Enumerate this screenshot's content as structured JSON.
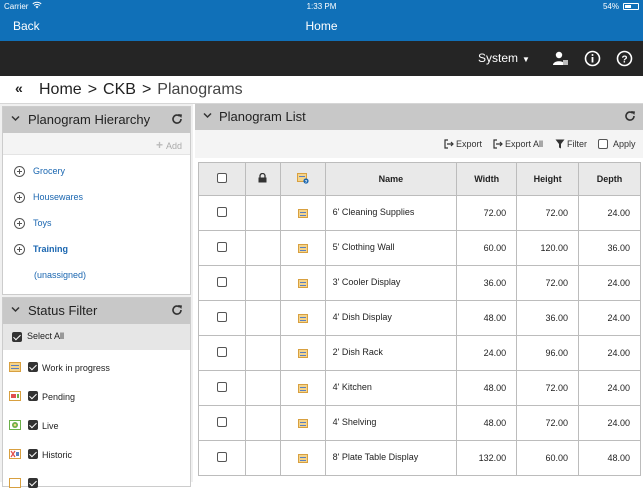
{
  "statusbar": {
    "carrier": "Carrier",
    "time": "1:33 PM",
    "battery": "54%",
    "battery_level": 0.54
  },
  "navbar": {
    "back_label": "Back",
    "title": "Home"
  },
  "toolbar": {
    "system_label": "System",
    "icons": [
      "user-icon",
      "info-icon",
      "help-icon"
    ]
  },
  "breadcrumb": {
    "collapse_glyph": "«",
    "items": [
      "Home",
      "CKB",
      "Planograms"
    ],
    "separator": ">"
  },
  "hierarchy": {
    "title": "Planogram Hierarchy",
    "add_label": "Add",
    "items": [
      {
        "label": "Grocery",
        "expandable": true,
        "bold": false
      },
      {
        "label": "Housewares",
        "expandable": true,
        "bold": false
      },
      {
        "label": "Toys",
        "expandable": true,
        "bold": false
      },
      {
        "label": "Training",
        "expandable": true,
        "bold": true
      },
      {
        "label": "(unassigned)",
        "expandable": false,
        "bold": false
      }
    ]
  },
  "status_filter": {
    "title": "Status Filter",
    "select_all_label": "Select All",
    "select_all_checked": true,
    "items": [
      {
        "label": "Work in progress",
        "checked": true,
        "icon": "wip-status-icon"
      },
      {
        "label": "Pending",
        "checked": true,
        "icon": "pending-status-icon"
      },
      {
        "label": "Live",
        "checked": true,
        "icon": "live-status-icon"
      },
      {
        "label": "Historic",
        "checked": true,
        "icon": "historic-status-icon"
      }
    ]
  },
  "planogram_list": {
    "title": "Planogram List",
    "toolbar": {
      "export": "Export",
      "export_all": "Export All",
      "filter": "Filter",
      "apply": "Apply"
    },
    "columns": [
      "",
      "",
      "",
      "Name",
      "Width",
      "Height",
      "Depth"
    ],
    "rows": [
      {
        "name": "6' Cleaning Supplies",
        "width": "72.00",
        "height": "72.00",
        "depth": "24.00"
      },
      {
        "name": "5' Clothing Wall",
        "width": "60.00",
        "height": "120.00",
        "depth": "36.00"
      },
      {
        "name": "3' Cooler Display",
        "width": "36.00",
        "height": "72.00",
        "depth": "24.00"
      },
      {
        "name": "4' Dish Display",
        "width": "48.00",
        "height": "36.00",
        "depth": "24.00"
      },
      {
        "name": "2' Dish Rack",
        "width": "24.00",
        "height": "96.00",
        "depth": "24.00"
      },
      {
        "name": "4' Kitchen",
        "width": "48.00",
        "height": "72.00",
        "depth": "24.00"
      },
      {
        "name": "4' Shelving",
        "width": "48.00",
        "height": "72.00",
        "depth": "24.00"
      },
      {
        "name": "8' Plate Table Display",
        "width": "132.00",
        "height": "60.00",
        "depth": "48.00"
      }
    ]
  }
}
